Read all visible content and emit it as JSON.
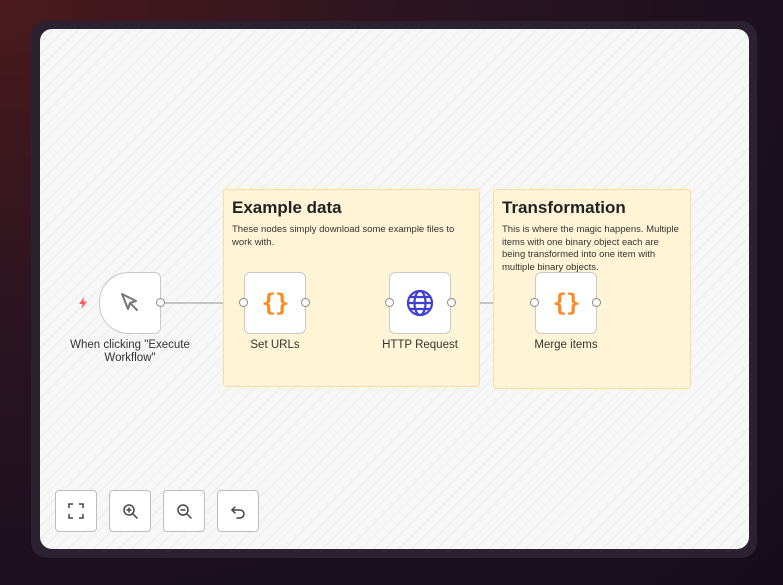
{
  "sticky_notes": [
    {
      "title": "Example data",
      "body": "These nodes simply download some example files to work with."
    },
    {
      "title": "Transformation",
      "body": "This is where the magic happens. Multiple items with one binary object each are being transformed into one item with multiple binary objects."
    }
  ],
  "nodes": {
    "trigger": {
      "label": "When clicking \"Execute Workflow\"",
      "icon": "cursor-icon"
    },
    "set_urls": {
      "label": "Set URLs",
      "icon": "code-braces-icon"
    },
    "http_request": {
      "label": "HTTP Request",
      "icon": "globe-icon"
    },
    "merge_items": {
      "label": "Merge items",
      "icon": "code-braces-icon"
    }
  },
  "controls": [
    "zoom-to-fit",
    "zoom-in",
    "zoom-out",
    "reset-zoom"
  ],
  "colors": {
    "sticky_bg": "#fff5d6",
    "code_icon": "#ff8a1f",
    "globe_icon": "#3f3fcf",
    "trigger_bolt": "#ff5a5a"
  }
}
